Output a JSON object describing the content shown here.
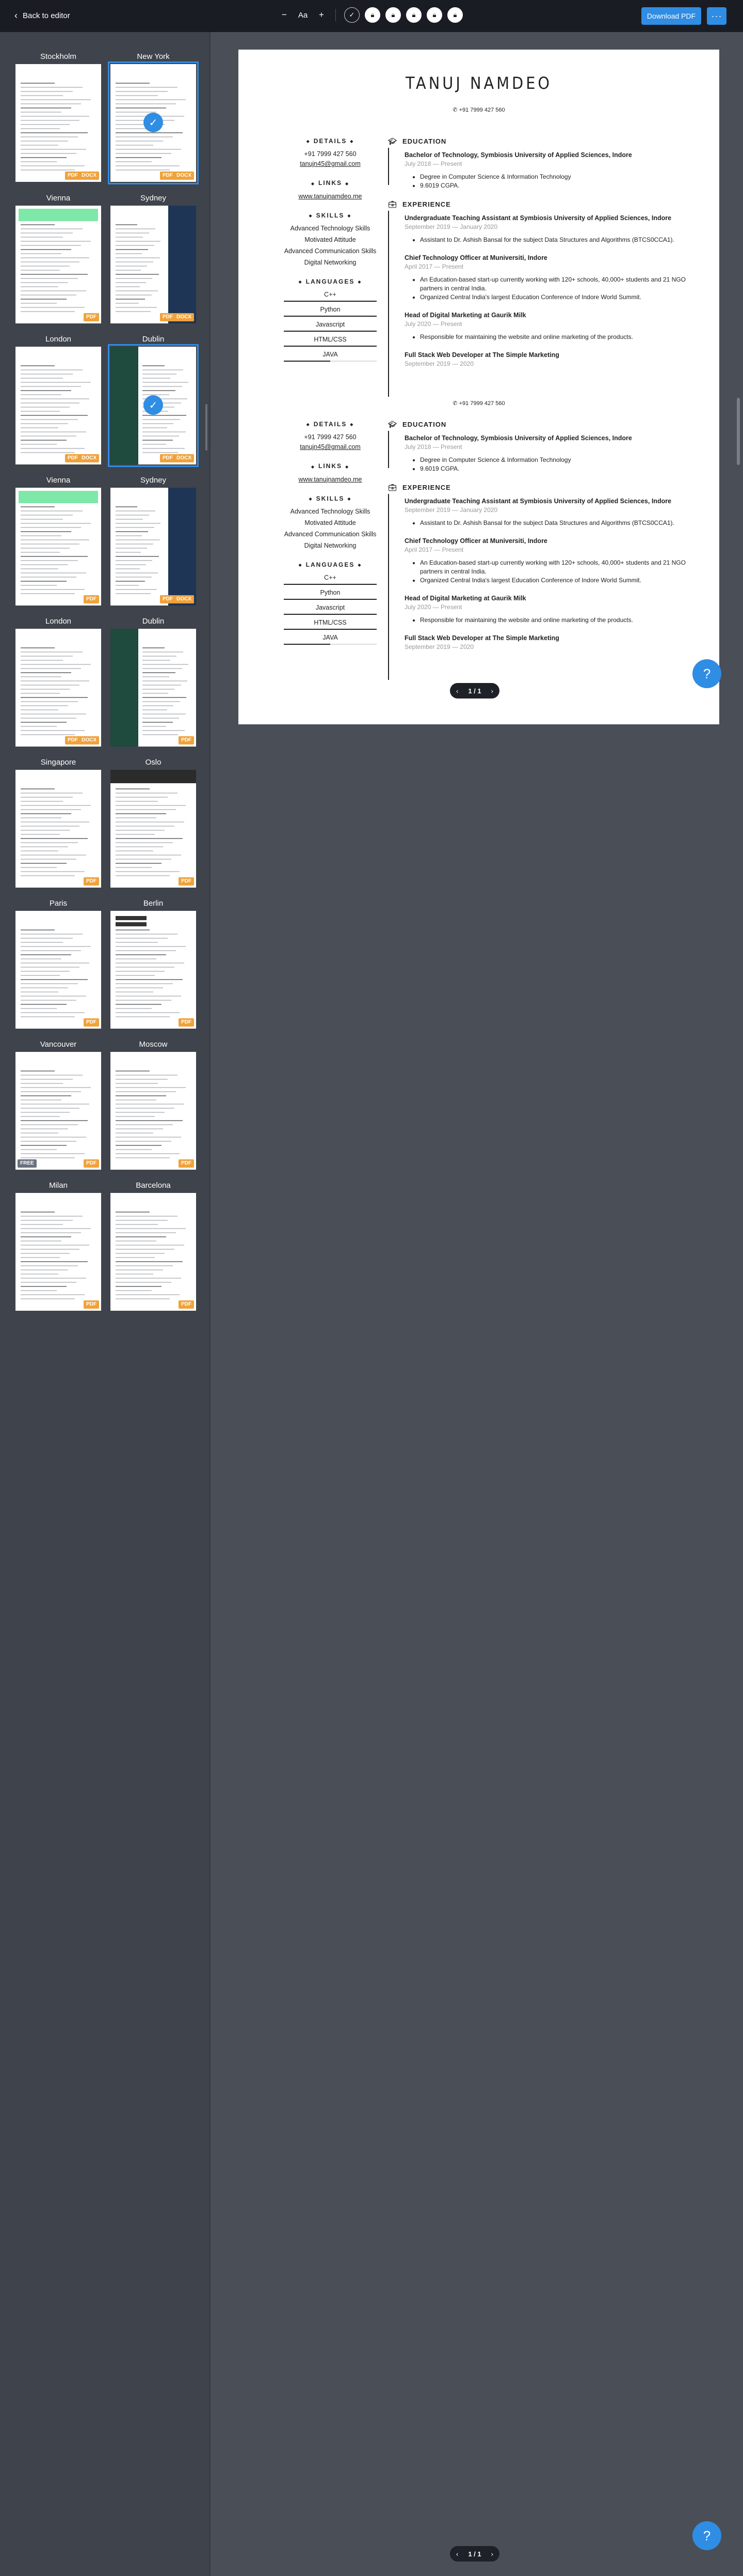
{
  "topbar": {
    "back_label": "Back to editor",
    "font_smaller": "−",
    "font_label": "Aa",
    "font_larger": "+",
    "download_label": "Download PDF",
    "more_label": "···",
    "color_options": [
      "selected-check-icon",
      "lock-icon",
      "lock-icon",
      "lock-icon",
      "lock-icon",
      "lock-icon"
    ]
  },
  "templates": [
    {
      "name": "Stockholm",
      "badges": [
        "PDF",
        "DOCX"
      ]
    },
    {
      "name": "New York",
      "badges": [
        "PDF",
        "DOCX"
      ],
      "selected": true
    },
    {
      "name": "Vienna",
      "badges": [
        "PDF"
      ]
    },
    {
      "name": "Sydney",
      "badges": [
        "PDF",
        "DOCX"
      ]
    },
    {
      "name": "London",
      "badges": [
        "PDF",
        "DOCX"
      ]
    },
    {
      "name": "Dublin",
      "badges": [
        "PDF",
        "DOCX"
      ],
      "selected": true
    },
    {
      "name": "Vienna",
      "badges": [
        "PDF"
      ]
    },
    {
      "name": "Sydney",
      "badges": [
        "PDF",
        "DOCX"
      ]
    },
    {
      "name": "London",
      "badges": [
        "PDF",
        "DOCX"
      ]
    },
    {
      "name": "Dublin",
      "badges": [
        "PDF"
      ]
    },
    {
      "name": "Singapore",
      "badges": [
        "PDF"
      ]
    },
    {
      "name": "Oslo",
      "badges": [
        "PDF"
      ]
    },
    {
      "name": "Paris",
      "badges": [
        "PDF"
      ]
    },
    {
      "name": "Berlin",
      "badges": [
        "PDF"
      ]
    },
    {
      "name": "Vancouver",
      "badges": [
        "FREE",
        "PDF"
      ]
    },
    {
      "name": "Moscow",
      "badges": [
        "PDF"
      ]
    },
    {
      "name": "Milan",
      "badges": [
        "PDF"
      ]
    },
    {
      "name": "Barcelona",
      "badges": [
        "PDF"
      ]
    }
  ],
  "resume": {
    "name": "TANUJ NAMDEO",
    "phone_top": "+91 7999 427 560",
    "details_heading": "DETAILS",
    "details": [
      "+91 7999 427 560",
      "tanujn45@gmail.com"
    ],
    "links_heading": "LINKS",
    "link": "www.tanujnamdeo.me",
    "skills_heading": "SKILLS",
    "skills": [
      "Advanced Technology Skills",
      "Motivated Attitude",
      "Advanced Communication Skills",
      "Digital Networking"
    ],
    "languages_heading": "LANGUAGES",
    "languages": [
      "C++",
      "Python",
      "Javascript",
      "HTML/CSS",
      "JAVA"
    ],
    "education_heading": "EDUCATION",
    "education": {
      "title": "Bachelor of Technology, Symbiosis University of Applied Sciences, Indore",
      "date": "July 2018 — Present",
      "bullets": [
        "Degree in Computer Science & Information Technology",
        "9.6019 CGPA."
      ]
    },
    "experience_heading": "EXPERIENCE",
    "experience": [
      {
        "title": "Undergraduate Teaching Assistant at Symbiosis University of Applied Sciences, Indore",
        "date": "September 2019 — January 2020",
        "bullets": [
          "Assistant to Dr. Ashish Bansal for the subject Data Structures and Algorithms (BTCS0CCA1)."
        ]
      },
      {
        "title": "Chief Technology Officer at Muniversiti, Indore",
        "date": "April 2017 — Present",
        "bullets": [
          "An Education-based start-up currently working with 120+ schools, 40,000+ students and 21 NGO partners in central India.",
          "Organized Central India's largest Education Conference of Indore World Summit."
        ]
      },
      {
        "title": "Head of Digital Marketing at Gaurik Milk",
        "date": "July 2020 — Present",
        "bullets": [
          "Responsible for maintaining the website and online marketing of the products."
        ]
      },
      {
        "title": "Full Stack Web Developer at The Simple Marketing",
        "date": "September 2019 — 2020",
        "bullets": []
      }
    ]
  },
  "pager": {
    "prev": "‹",
    "label": "1 / 1",
    "next": "›"
  },
  "help_label": "?"
}
